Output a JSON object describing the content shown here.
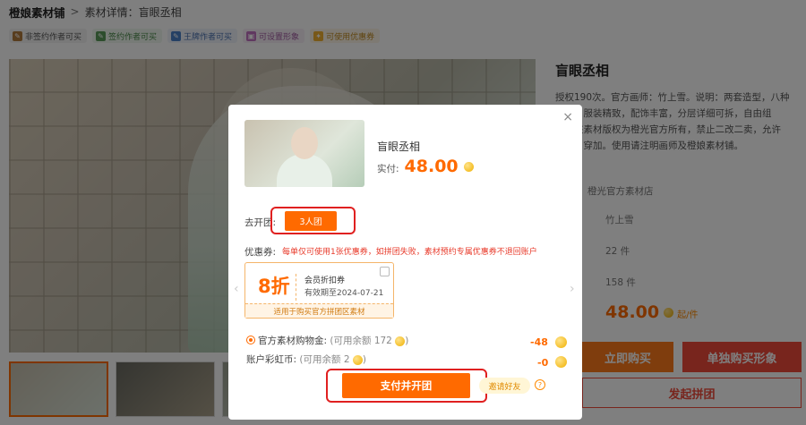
{
  "breadcrumb": {
    "home": "橙娘素材铺",
    "sep": ">",
    "current": "素材详情：盲眼丞相"
  },
  "tags": [
    {
      "label": "非签约作者可买",
      "icon": "pencil-icon"
    },
    {
      "label": "签约作者可买",
      "icon": "pencil-icon"
    },
    {
      "label": "王牌作者可买",
      "icon": "pencil-icon"
    },
    {
      "label": "可设置形象",
      "icon": "image-icon"
    },
    {
      "label": "可使用优惠券",
      "icon": "ticket-icon"
    }
  ],
  "detail": {
    "title": "盲眼丞相",
    "description": "授权190次。官方画师：竹上雪。说明：两套造型，八种表情，服装精致，配饰丰富，分层详细可拆，自由组合。该素材版权为橙光官方所有，禁止二改二卖，允许微调、穿加。使用请注明画师及橙娘素材铺。",
    "shop": "橙光官方素材店",
    "artist": "竹上雪",
    "count1": "22 件",
    "count2": "158 件",
    "price": "48.00",
    "price_unit": "起/件",
    "btn_buy": "立即购买",
    "btn_single": "单独购买形象",
    "btn_group": "发起拼团"
  },
  "modal": {
    "close": "×",
    "product_name": "盲眼丞相",
    "pay_label": "实付:",
    "pay_amount": "48.00",
    "group_label": "去开团:",
    "group_option": "3人团",
    "coupon_label": "优惠券:",
    "coupon_notice": "每单仅可使用1张优惠券，如拼团失败，素材预约专属优惠券不退回账户",
    "coupon": {
      "discount": "8折",
      "name": "会员折扣券",
      "expiry": "有效期至2024-07-21",
      "scope": "适用于购买官方拼团区素材"
    },
    "balance1": {
      "label": "官方素材购物金:",
      "available": "(可用余额 172",
      "close_paren": ")",
      "amount": "-48"
    },
    "balance2": {
      "label": "账户彩虹币:",
      "available": "(可用余额 2",
      "close_paren": ")",
      "amount": "-0"
    },
    "pay_button": "支付并开团",
    "invite": "邀请好友",
    "help": "?"
  },
  "colors": {
    "accent": "#ff6a00",
    "alert": "#e83a2a",
    "buy_red": "#f04a3a"
  }
}
